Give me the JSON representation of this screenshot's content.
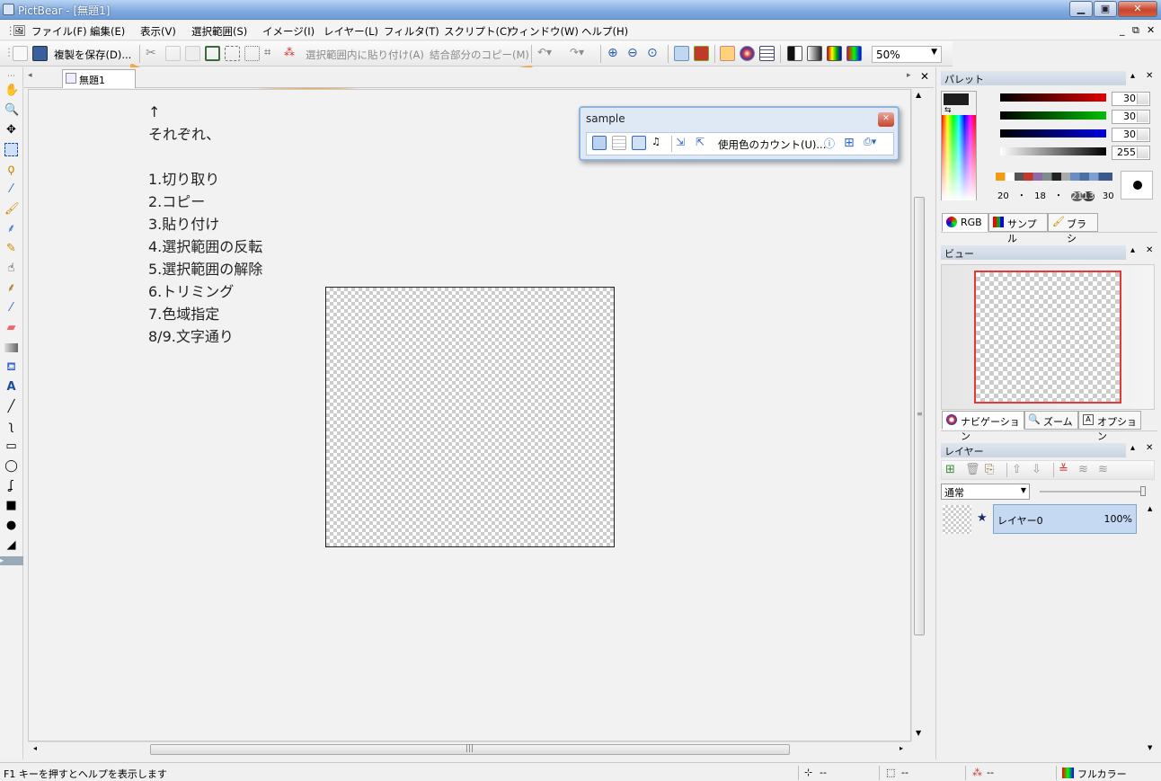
{
  "window": {
    "title": "PictBear - [無題1]"
  },
  "menu": [
    "ファイル(F)",
    "編集(E)",
    "表示(V)",
    "選択範囲(S)",
    "イメージ(I)",
    "レイヤー(L)",
    "フィルタ(T)",
    "スクリプト(C)",
    "ウィンドウ(W)",
    "ヘルプ(H)"
  ],
  "mdi_controls": [
    "_",
    "⧉",
    "✕"
  ],
  "toolbar": {
    "save_copy": "複製を保存(D)...",
    "paste_into_selection": "選択範囲内に貼り付け(A)",
    "copy_merged": "結合部分のコピー(M)",
    "zoom": "50%"
  },
  "doc_tab": {
    "label": "無題1"
  },
  "canvas_note": {
    "lines": [
      "↑",
      "それぞれ、",
      "",
      "1.切り取り",
      "2.コピー",
      "3.貼り付け",
      "4.選択範囲の反転",
      "5.選択範囲の解除",
      "6.トリミング",
      "7.色域指定",
      "8/9.文字通り"
    ]
  },
  "float_window": {
    "title": "sample",
    "count_colors": "使用色のカウント(U)..."
  },
  "palette": {
    "title": "パレット",
    "r": "30",
    "g": "30",
    "b": "30",
    "a": "255",
    "brush_sizes": [
      "20",
      "・",
      "18",
      "・",
      "21",
      "13",
      "30"
    ],
    "tabs": [
      "RGB",
      "サンプル",
      "ブラシ"
    ],
    "colors": {
      "red": "#e00000",
      "green": "#00c000",
      "blue": "#0000e0",
      "current": "#1e1e1e"
    }
  },
  "view": {
    "title": "ビュー",
    "tabs": [
      "ナビゲーション",
      "ズーム",
      "オプション"
    ]
  },
  "layers": {
    "title": "レイヤー",
    "blend_mode": "通常",
    "layer_name": "レイヤー0",
    "opacity": "100%"
  },
  "status": {
    "help": "F1 キーを押すとヘルプを表示します",
    "pos": "--",
    "size": "--",
    "color": "--",
    "mode": "フルカラー"
  }
}
